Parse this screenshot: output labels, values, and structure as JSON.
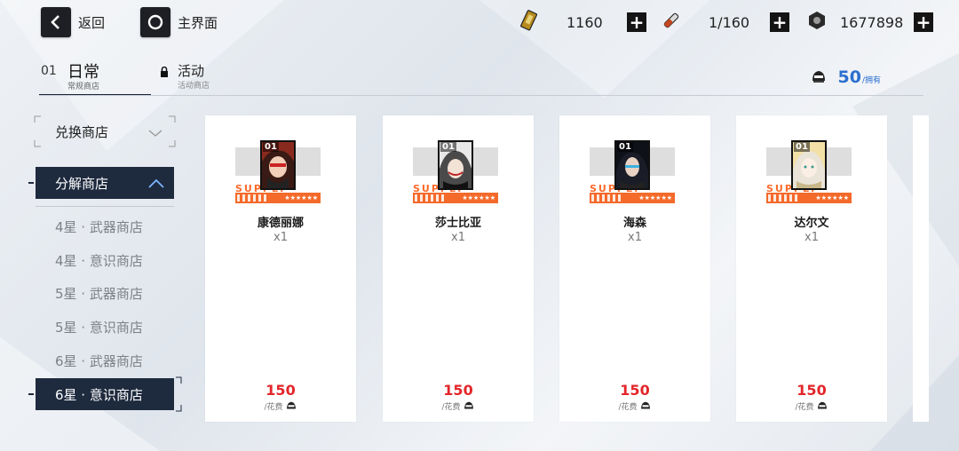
{
  "topbar": {
    "back_label": "返回",
    "home_label": "主界面",
    "resources": [
      {
        "icon": "stamina-card-icon",
        "value": "1160"
      },
      {
        "icon": "blood-vial-icon",
        "value": "1/160"
      },
      {
        "icon": "coin-icon",
        "value": "1677898"
      }
    ],
    "plus_label": "+"
  },
  "tabs": [
    {
      "num": "01",
      "title": "日常",
      "subtitle": "常规商店",
      "active": true
    },
    {
      "title": "活动",
      "subtitle": "活动商店",
      "locked": true
    }
  ],
  "owned": {
    "value": "50",
    "label": "/拥有",
    "icon": "currency-icon"
  },
  "sidebar": {
    "exchange": "兑换商店",
    "decompose": "分解商店",
    "items": [
      {
        "label": "4星 · 武器商店"
      },
      {
        "label": "4星 · 意识商店"
      },
      {
        "label": "5星 · 武器商店"
      },
      {
        "label": "5星 · 意识商店"
      },
      {
        "label": "6星 · 武器商店"
      },
      {
        "label": "6星 · 意识商店",
        "active": true
      }
    ]
  },
  "cards": [
    {
      "num": "01",
      "name": "康德丽娜",
      "qty": "x1",
      "price": "150",
      "cost_label": "/花费",
      "supply": "SUPPLY",
      "stars": "★★★★★★"
    },
    {
      "num": "01",
      "name": "莎士比亚",
      "qty": "x1",
      "price": "150",
      "cost_label": "/花费",
      "supply": "SUPPLY",
      "stars": "★★★★★★"
    },
    {
      "num": "01",
      "name": "海森",
      "qty": "x1",
      "price": "150",
      "cost_label": "/花费",
      "supply": "SUPPLY",
      "stars": "★★★★★★"
    },
    {
      "num": "01",
      "name": "达尔文",
      "qty": "x1",
      "price": "150",
      "cost_label": "/花费",
      "supply": "SUPPLY",
      "stars": "★★★★★★"
    }
  ],
  "colors": {
    "accent": "#2b6fd0",
    "price": "#e3262a",
    "supply": "#f36a2a",
    "active_bg": "#1e2a3e"
  }
}
